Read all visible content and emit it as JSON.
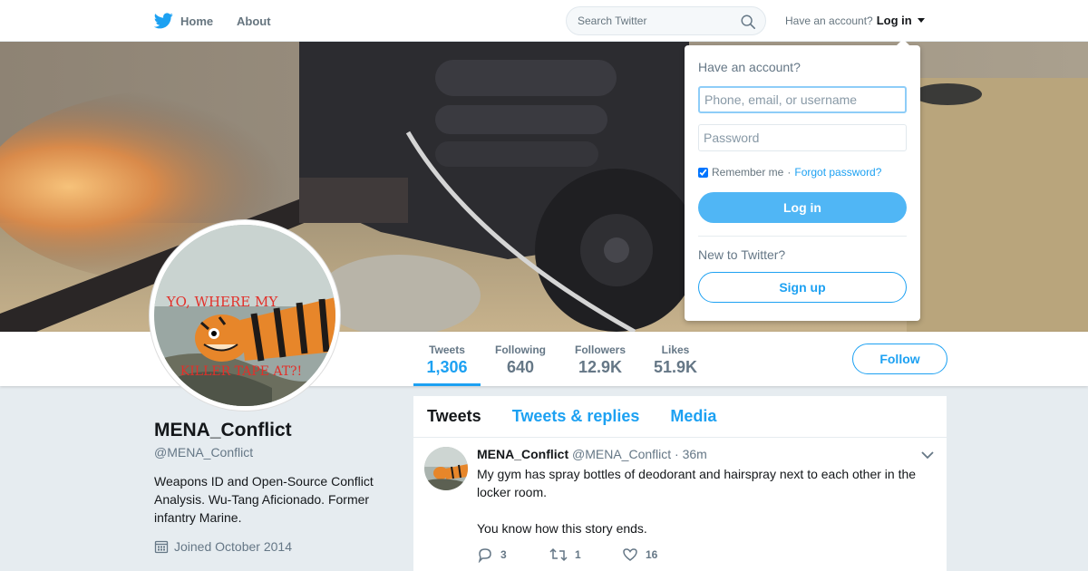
{
  "topbar": {
    "home_label": "Home",
    "about_label": "About",
    "search_placeholder": "Search Twitter",
    "have_account_text": "Have an account?",
    "login_label": "Log in"
  },
  "profile": {
    "name": "MENA_Conflict",
    "handle": "@MENA_Conflict",
    "bio": "Weapons ID and Open-Source Conflict Analysis. Wu-Tang Aficionado. Former infantry Marine.",
    "joined": "Joined October 2014",
    "avatar_caption_top": "YO, WHERE MY",
    "avatar_caption_bottom": "KILLER TAPE AT?!"
  },
  "stats": [
    {
      "label": "Tweets",
      "value": "1,306",
      "active": true
    },
    {
      "label": "Following",
      "value": "640",
      "active": false
    },
    {
      "label": "Followers",
      "value": "12.9K",
      "active": false
    },
    {
      "label": "Likes",
      "value": "51.9K",
      "active": false
    }
  ],
  "follow_label": "Follow",
  "timeline": {
    "tabs": [
      "Tweets",
      "Tweets & replies",
      "Media"
    ],
    "tweet": {
      "name": "MENA_Conflict",
      "handle": "@MENA_Conflict",
      "separator": "·",
      "time": "36m",
      "text_line1": "My gym has spray bottles of deodorant and hairspray next to each other in the locker room.",
      "text_line2": "You know how this story ends.",
      "replies": "3",
      "retweets": "1",
      "likes": "16"
    }
  },
  "login_dropdown": {
    "title": "Have an account?",
    "username_placeholder": "Phone, email, or username",
    "password_placeholder": "Password",
    "remember_label": "Remember me",
    "separator": "·",
    "forgot_label": "Forgot password?",
    "login_button": "Log in",
    "new_text": "New to Twitter?",
    "signup_button": "Sign up"
  },
  "colors": {
    "accent": "#1da1f2",
    "login_button": "#50b6f5",
    "background": "#e6ecf0"
  }
}
